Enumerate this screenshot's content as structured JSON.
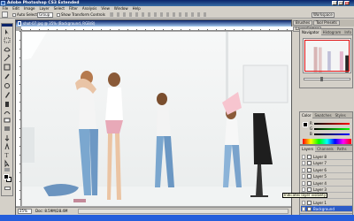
{
  "window": {
    "title": "Adobe Photoshop CS3 Extended",
    "controls": [
      "_",
      "□",
      "×"
    ]
  },
  "menu": [
    "File",
    "Edit",
    "Image",
    "Layer",
    "Select",
    "Filter",
    "Analysis",
    "View",
    "Window",
    "Help"
  ],
  "options": {
    "auto_select_label": "Auto Select:",
    "auto_select_value": "Group",
    "show_transform_label": "Show Transform Controls",
    "workspace_label": "Workspace"
  },
  "palette_well": [
    "Brushes",
    "Tool Presets",
    "Layer Comps"
  ],
  "document": {
    "title": "shot-07.jpg @ 35% (Background, RGB/8)",
    "zoom": "25%",
    "doc_info": "Doc: 8.59M/28.4M"
  },
  "navigator": {
    "tabs": [
      "Navigator",
      "Histogram",
      "Info"
    ],
    "zoom_level": 0.35
  },
  "color_panel": {
    "tabs": [
      "Color",
      "Swatches",
      "Styles"
    ],
    "channels": [
      "R",
      "G",
      "B"
    ]
  },
  "layers": {
    "tabs": [
      "Layers",
      "Channels",
      "Paths"
    ],
    "items": [
      "Layer 8",
      "Layer 7",
      "Layer 6",
      "Layer 5",
      "Layer 4",
      "Layer 3",
      "Layer 2",
      "Layer 1",
      "Background"
    ],
    "selected_index": 8,
    "tooltip": "Indicates layer visibility"
  },
  "colors": {
    "title_bar": "#0a246a",
    "panel_bg": "#d4d0c8",
    "selection": "#2b5bc7",
    "nav_viewbox": "#e01010",
    "taskbar": "#245edb"
  }
}
